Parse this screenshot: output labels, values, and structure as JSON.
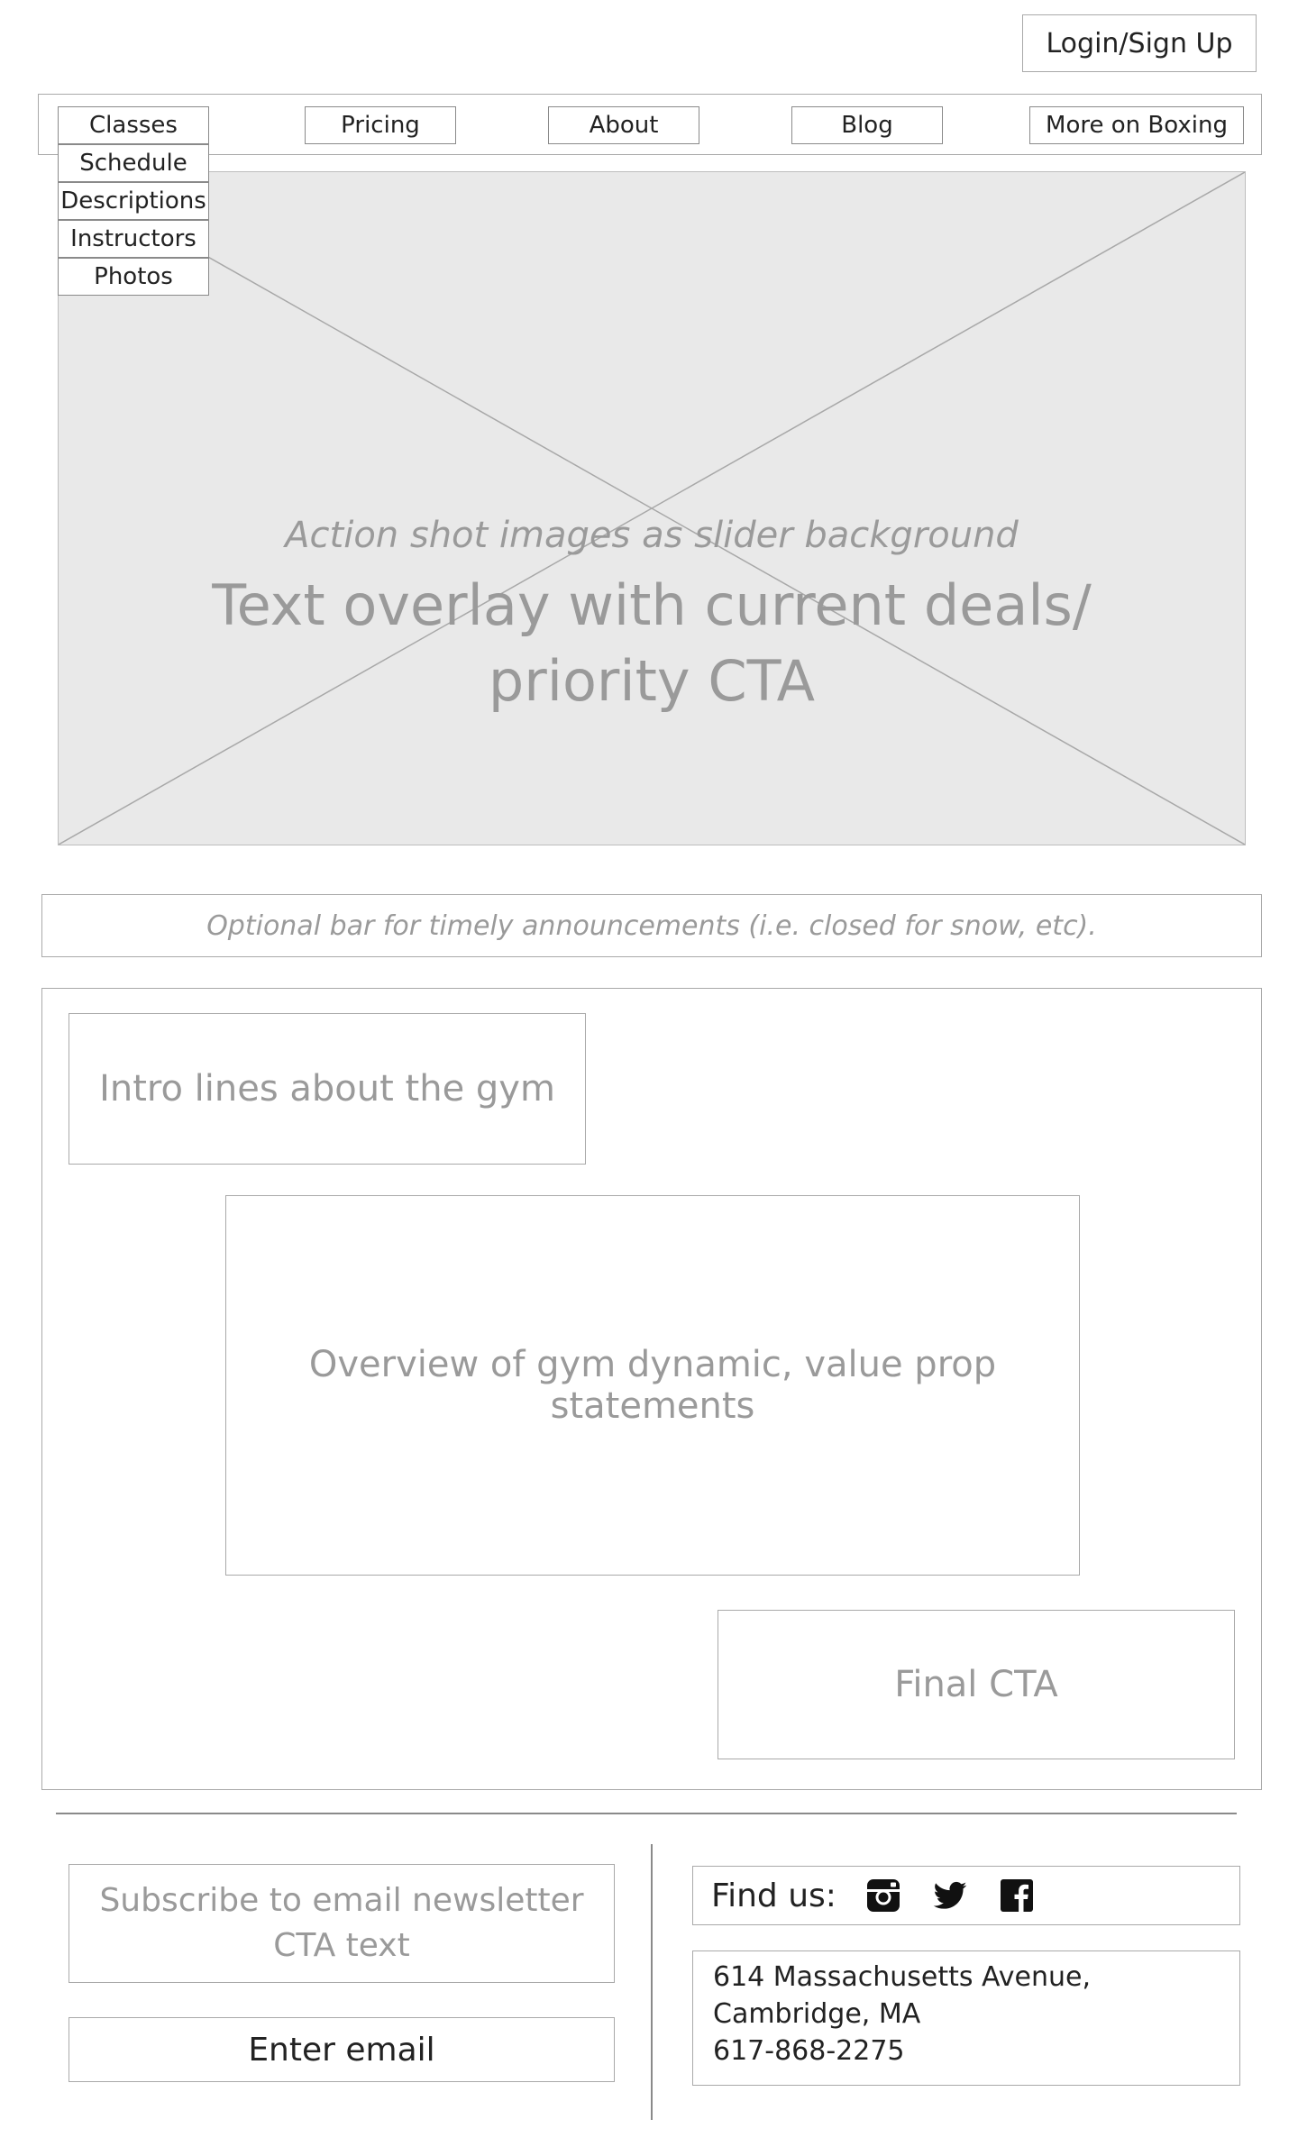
{
  "header": {
    "login_label": "Login/Sign Up"
  },
  "nav": {
    "items": [
      {
        "label": "Classes"
      },
      {
        "label": "Pricing"
      },
      {
        "label": "About"
      },
      {
        "label": "Blog"
      },
      {
        "label": "More on Boxing"
      }
    ],
    "classes_dropdown": [
      {
        "label": "Schedule"
      },
      {
        "label": "Descriptions"
      },
      {
        "label": "Instructors"
      },
      {
        "label": "Photos"
      }
    ]
  },
  "hero": {
    "caption": "Action shot images as slider background",
    "overlay_line1": "Text overlay with current deals/",
    "overlay_line2": "priority CTA"
  },
  "announcement": {
    "text": "Optional bar for timely announcements (i.e. closed for snow, etc)."
  },
  "main": {
    "intro": "Intro lines about the gym",
    "overview": "Overview of gym dynamic, value prop statements",
    "final_cta": "Final CTA"
  },
  "footer": {
    "subscribe_line1": "Subscribe to email newsletter",
    "subscribe_line2": "CTA text",
    "email_placeholder": "Enter email",
    "find_us_label": "Find us:",
    "social_icons": [
      "instagram-icon",
      "twitter-icon",
      "facebook-icon"
    ],
    "address_line1": "614 Massachusetts Avenue,",
    "address_line2": "Cambridge, MA",
    "phone": "617-868-2275"
  }
}
